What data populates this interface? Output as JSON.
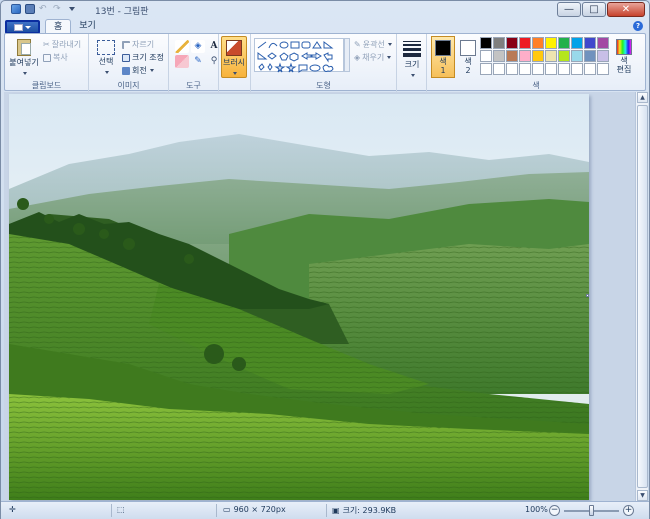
{
  "window": {
    "title": "13번 - 그림판",
    "controls": {
      "minimize": "—",
      "maximize": "□",
      "close": "✕"
    }
  },
  "tabs": [
    {
      "label": "홈",
      "active": true
    },
    {
      "label": "보기",
      "active": false
    }
  ],
  "help_glyph": "?",
  "ribbon": {
    "clipboard": {
      "group_label": "클립보드",
      "paste_label": "붙여넣기",
      "cut_label": "잘라내기",
      "copy_label": "복사"
    },
    "image": {
      "group_label": "이미지",
      "select_label": "선택",
      "crop_label": "자르기",
      "resize_label": "크기 조정",
      "rotate_label": "회전"
    },
    "tools": {
      "group_label": "도구",
      "text_glyph": "A"
    },
    "brushes": {
      "label": "브러시"
    },
    "shapes": {
      "group_label": "도형",
      "outline_label": "윤곽선",
      "fill_label": "채우기"
    },
    "size": {
      "label": "크기"
    },
    "colors": {
      "group_label": "색",
      "color1_label": "색\n1",
      "color2_label": "색\n2",
      "color1_value": "#000000",
      "color2_value": "#ffffff",
      "edit_label": "색\n편집",
      "palette": [
        "#000000",
        "#7f7f7f",
        "#880015",
        "#ed1c24",
        "#ff7f27",
        "#fff200",
        "#22b14c",
        "#00a2e8",
        "#3f48cc",
        "#a349a4",
        "#ffffff",
        "#c3c3c3",
        "#b97a57",
        "#ffaec9",
        "#ffc90e",
        "#efe4b0",
        "#b5e61d",
        "#99d9ea",
        "#7092be",
        "#c8bfe7",
        "#ffffff",
        "#ffffff",
        "#ffffff",
        "#ffffff",
        "#ffffff",
        "#ffffff",
        "#ffffff",
        "#ffffff",
        "#ffffff",
        "#ffffff"
      ]
    }
  },
  "statusbar": {
    "dimensions": "960 × 720px",
    "file_size": "크기: 293.9KB",
    "zoom": "100%",
    "zoom_out": "−",
    "zoom_in": "+"
  }
}
